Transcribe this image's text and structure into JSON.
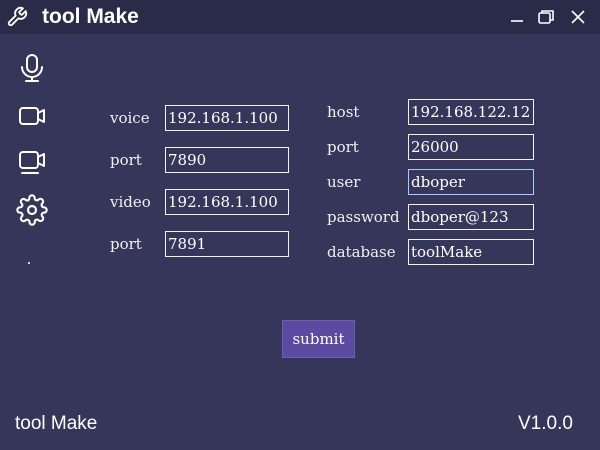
{
  "app": {
    "title": "tool Make",
    "icon": "wrench-icon"
  },
  "window_controls": [
    "minimize-icon",
    "restore-icon",
    "close-icon"
  ],
  "sidebar": {
    "items": [
      "microphone-icon",
      "video-camera-icon",
      "video-chat-icon",
      "gear-icon"
    ]
  },
  "left_form": {
    "voice": {
      "label": "voice",
      "value": "192.168.1.100"
    },
    "voice_port": {
      "label": "port",
      "value": "7890"
    },
    "video": {
      "label": "video",
      "value": "192.168.1.100"
    },
    "video_port": {
      "label": "port",
      "value": "7891"
    }
  },
  "right_form": {
    "host": {
      "label": "host",
      "value": "192.168.122.12"
    },
    "port": {
      "label": "port",
      "value": "26000"
    },
    "user": {
      "label": "user",
      "value": "dboper"
    },
    "password": {
      "label": "password",
      "value": "dboper@123"
    },
    "database": {
      "label": "database",
      "value": "toolMake"
    }
  },
  "submit_label": "submit",
  "footer": {
    "left": "tool Make",
    "version": "V1.0.0"
  },
  "colors": {
    "background": "#36365a",
    "titlebar": "#2a2a49",
    "button": "#5a4aa0",
    "text": "#ffffff"
  }
}
